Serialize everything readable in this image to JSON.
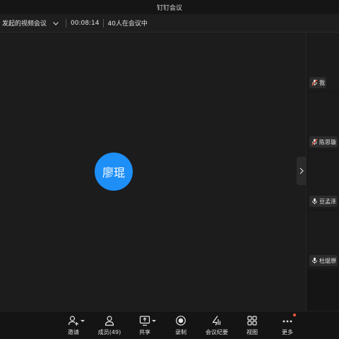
{
  "window": {
    "title": "钉钉会议"
  },
  "infobar": {
    "meeting_title": "发起的视频会议",
    "duration": "00:08:14",
    "participants_status": "40人在会议中"
  },
  "main": {
    "speaker_avatar_text": "廖琨"
  },
  "sidebar": {
    "tiles": [
      {
        "name": "我",
        "mic": "muted"
      },
      {
        "name": "陈思璇",
        "mic": "muted"
      },
      {
        "name": "豆孟泽",
        "mic": "on"
      },
      {
        "name": "杜焜想",
        "mic": "on"
      }
    ]
  },
  "toolbar": {
    "invite": "邀请",
    "members": "成员(49)",
    "share": "共享",
    "record": "录制",
    "minutes": "会议纪要",
    "view": "视图",
    "more": "更多"
  },
  "colors": {
    "avatar": "#1d8ff7",
    "notification_dot": "#ff5a3c",
    "muted_icon": "#e5533d"
  }
}
